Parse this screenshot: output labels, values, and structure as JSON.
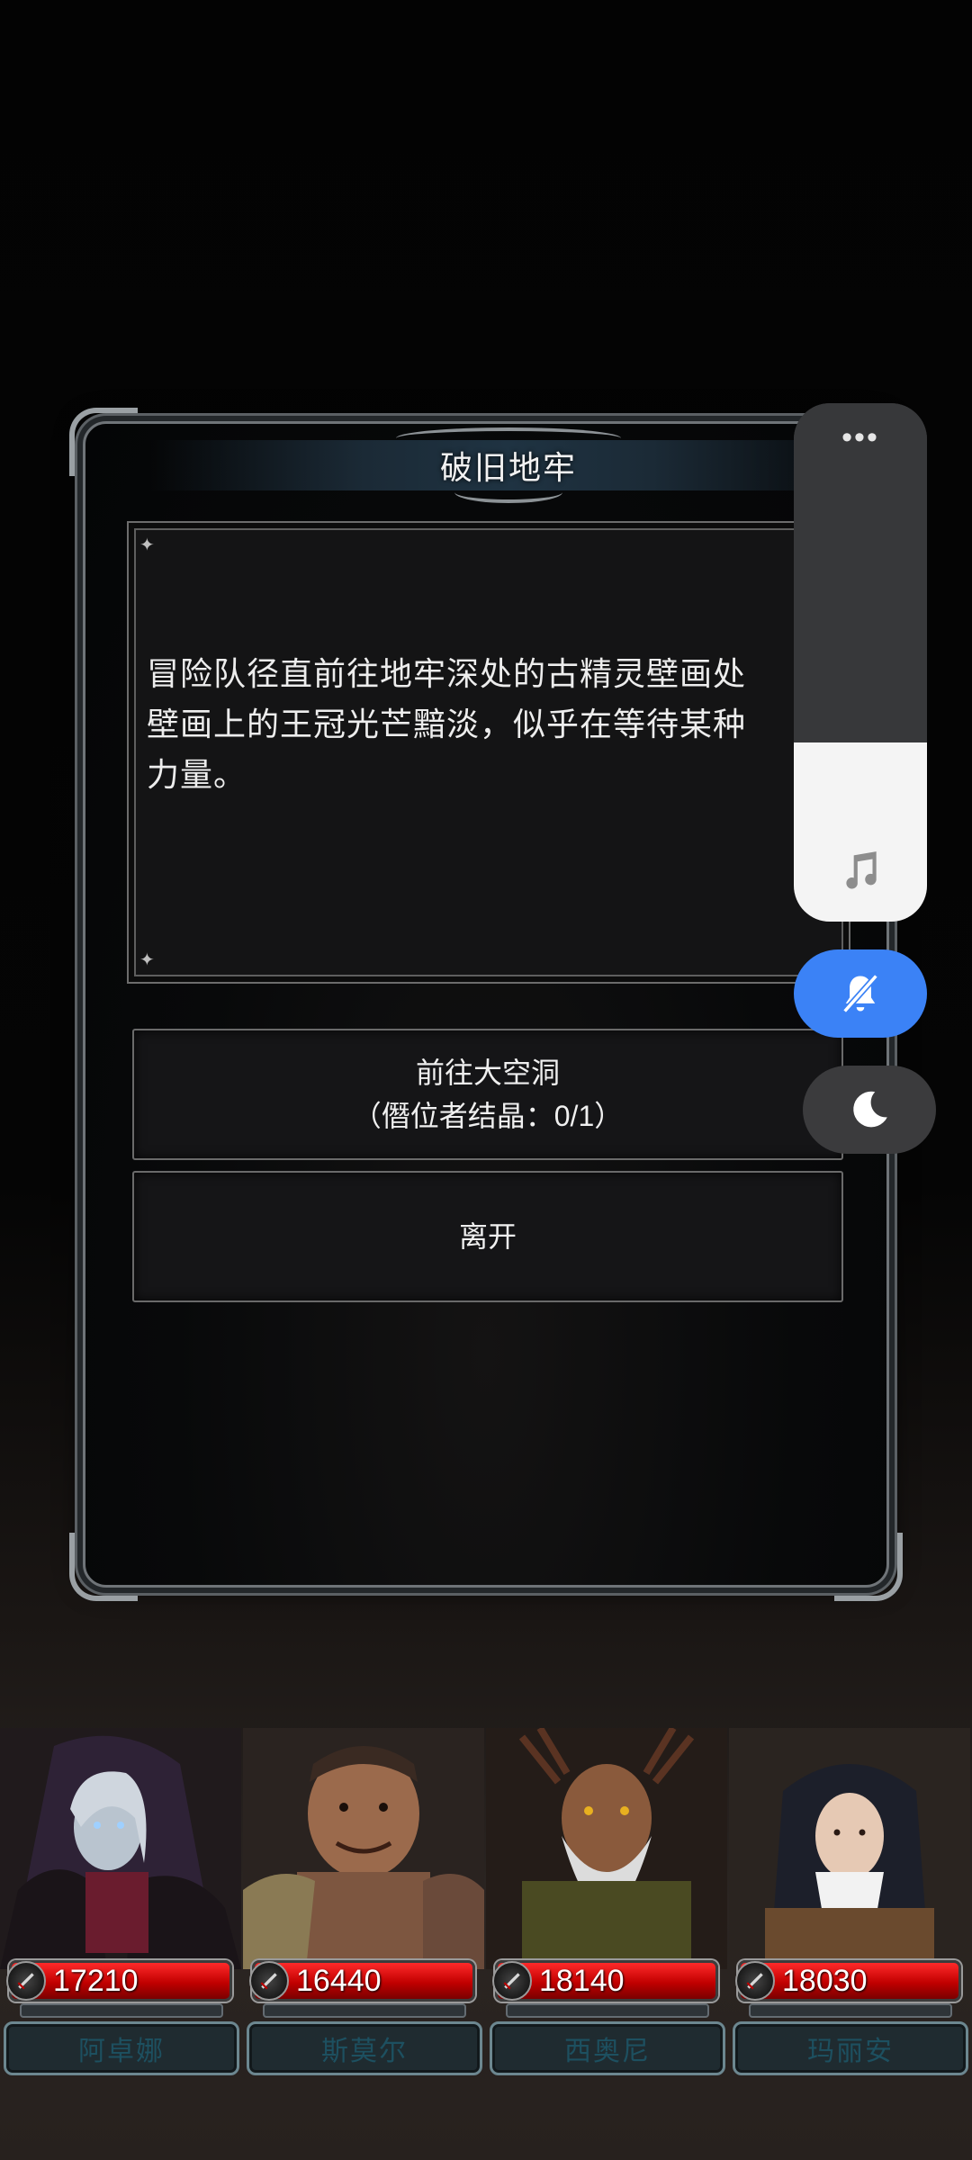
{
  "dialog": {
    "title": "破旧地牢",
    "story": "冒险队径直前往地牢深处的古精灵壁画处\n壁画上的王冠光芒黯淡，似乎在等待某种\n力量。",
    "choices": [
      {
        "line1": "前往大空洞",
        "line2": "（僭位者结晶：0/1）"
      },
      {
        "line1": "离开",
        "line2": ""
      }
    ]
  },
  "quick_panel": {
    "more_icon": "more-dots-icon",
    "music_icon": "music-note-icon",
    "volume_level": 0.35,
    "mute_icon": "bell-slash-icon",
    "mute_active_color": "#3b82f6",
    "dark_mode_icon": "moon-icon"
  },
  "party": [
    {
      "name": "阿卓娜",
      "power": "17210",
      "portrait": "sorceress-portrait"
    },
    {
      "name": "斯莫尔",
      "power": "16440",
      "portrait": "brute-portrait"
    },
    {
      "name": "西奥尼",
      "power": "18140",
      "portrait": "druid-portrait"
    },
    {
      "name": "玛丽安",
      "power": "18030",
      "portrait": "nun-portrait"
    }
  ],
  "colors": {
    "hp_red": "#e00000",
    "name_text": "#1d5060"
  }
}
